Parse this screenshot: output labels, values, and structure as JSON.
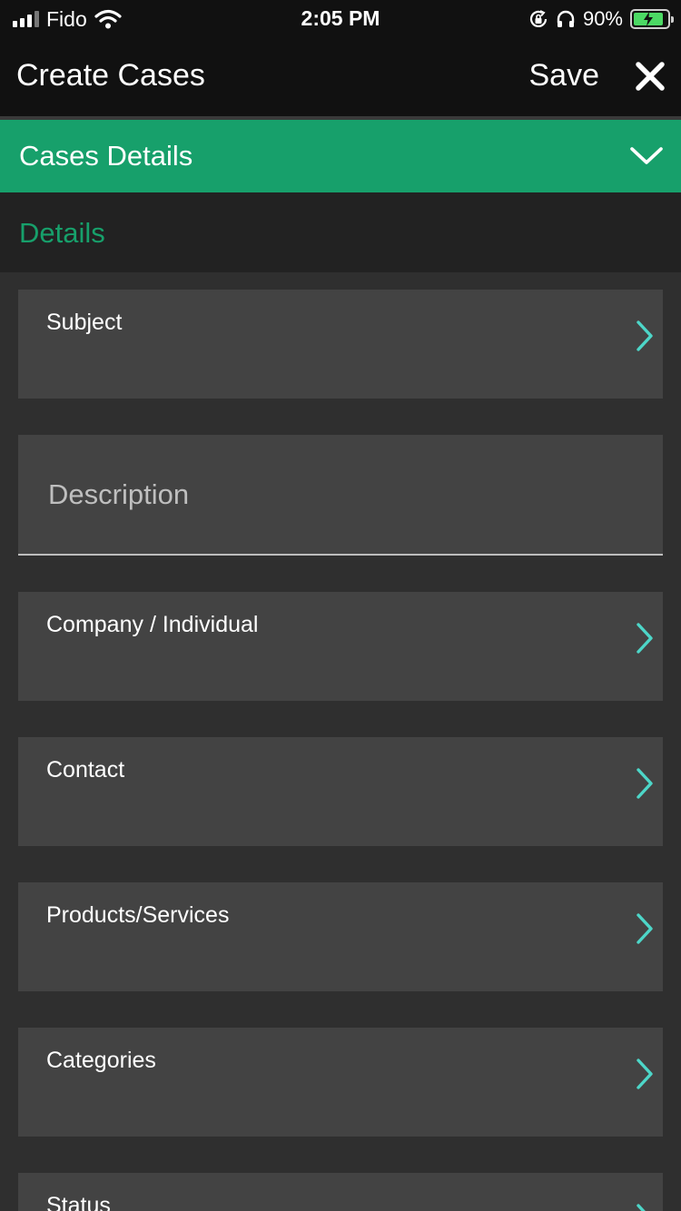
{
  "status_bar": {
    "carrier": "Fido",
    "time": "2:05 PM",
    "battery_percent": "90%",
    "battery_level": 0.9,
    "icons": [
      "signal-icon",
      "wifi-icon",
      "orientation-lock-icon",
      "headphones-icon",
      "battery-charging-icon"
    ]
  },
  "header": {
    "title": "Create Cases",
    "save_label": "Save",
    "close_icon": "close-icon"
  },
  "section": {
    "title": "Cases Details",
    "chevron_icon": "chevron-down-icon",
    "accent_color": "#17a06b"
  },
  "subsection": {
    "title": "Details"
  },
  "fields": {
    "subject": "Subject",
    "description_placeholder": "Description",
    "company": "Company / Individual",
    "contact": "Contact",
    "products": "Products/Services",
    "categories": "Categories",
    "status": "Status"
  },
  "colors": {
    "chevron": "#4dd6c8",
    "background": "#2f2f2f",
    "card": "#434343",
    "header": "#111111"
  }
}
